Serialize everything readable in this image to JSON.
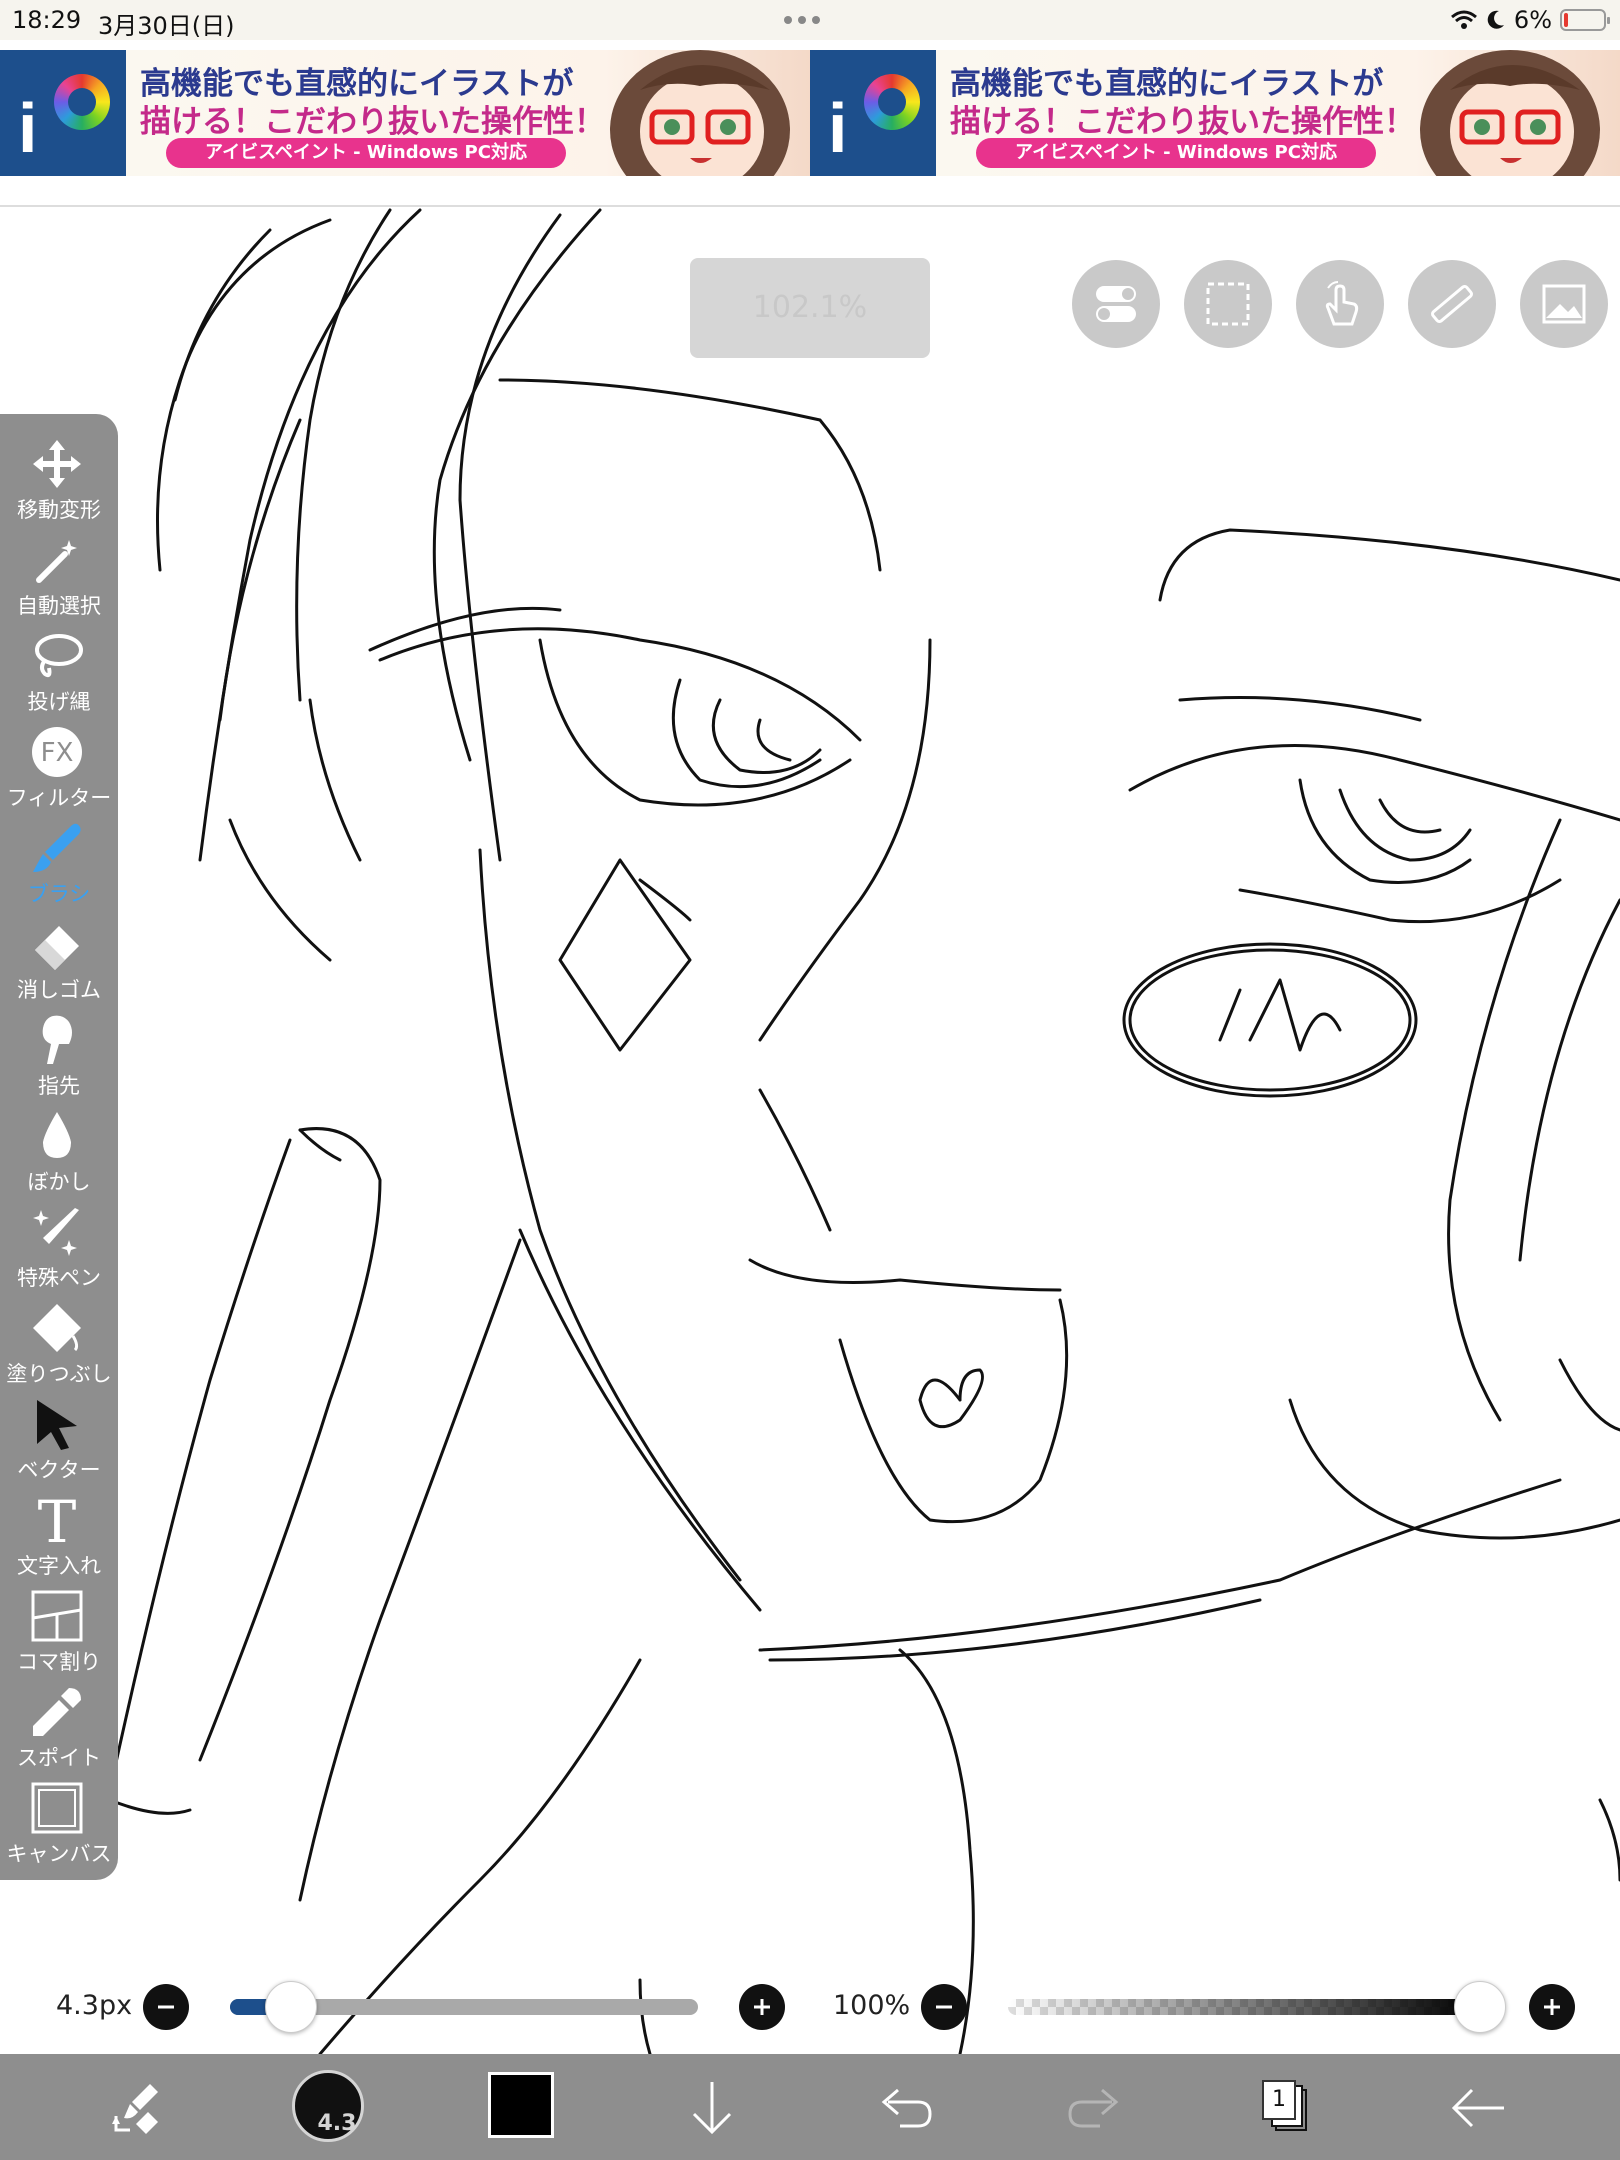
{
  "status_bar": {
    "time": "18:29",
    "date": "3月30日(日)",
    "battery": "6%"
  },
  "ad_banner": {
    "line1": "高機能でも直感的にイラストが",
    "line2": "描ける！こだわり抜いた操作性！",
    "cta": "アイビスペイント - Windows PC対応"
  },
  "zoom_indicator": "102.1%",
  "left_toolbar": {
    "tools": [
      {
        "label": "移動変形",
        "icon": "move-transform-icon"
      },
      {
        "label": "自動選択",
        "icon": "magic-wand-icon"
      },
      {
        "label": "投げ縄",
        "icon": "lasso-icon"
      },
      {
        "label": "フィルター",
        "icon": "fx-filter-icon"
      },
      {
        "label": "ブラシ",
        "icon": "brush-icon"
      },
      {
        "label": "消しゴム",
        "icon": "eraser-icon"
      },
      {
        "label": "指先",
        "icon": "smudge-finger-icon"
      },
      {
        "label": "ぼかし",
        "icon": "blur-drop-icon"
      },
      {
        "label": "特殊ペン",
        "icon": "special-pen-icon"
      },
      {
        "label": "塗りつぶし",
        "icon": "fill-bucket-icon"
      },
      {
        "label": "ベクター",
        "icon": "vector-cursor-icon"
      },
      {
        "label": "文字入れ",
        "icon": "text-icon"
      },
      {
        "label": "コマ割り",
        "icon": "frame-divider-icon"
      },
      {
        "label": "スポイト",
        "icon": "eyedropper-icon"
      },
      {
        "label": "キャンバス",
        "icon": "canvas-icon"
      }
    ],
    "fx_text": "FX",
    "active_tool": "ブラシ",
    "text_icon_glyph": "T"
  },
  "brush_controls": {
    "size_label": "4.3px",
    "size_value": 4.3,
    "size_fraction": 0.13,
    "opacity_label": "100%",
    "opacity_fraction": 1.0,
    "preview_label": "4.3"
  },
  "bottom_bar": {
    "layer_count": "1"
  },
  "colors": {
    "accent": "#3aa0f0",
    "toolbar_bg": "#8e8e8e",
    "current_color": "#000000"
  }
}
